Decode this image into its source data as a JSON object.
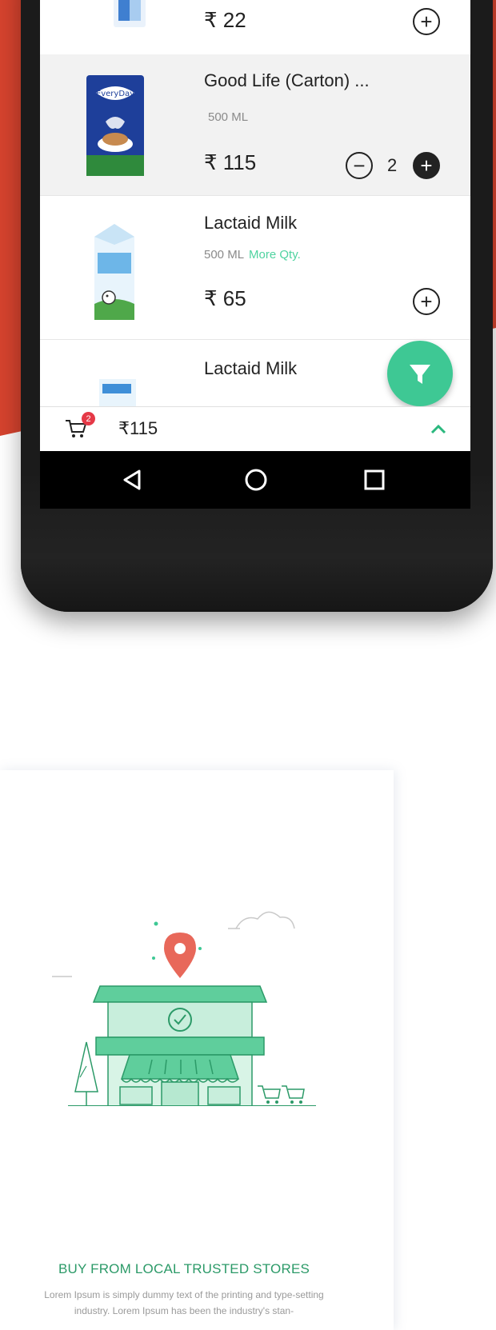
{
  "colors": {
    "accent_red": "#d6432e",
    "accent_green": "#3ec894",
    "store_green": "#2c9a68",
    "badge_red": "#e53947"
  },
  "products": [
    {
      "name": "",
      "size": "",
      "more_qty": "",
      "price": "₹ 22",
      "quantity": null
    },
    {
      "name": "Good Life (Carton) ...",
      "size": "500 ML",
      "more_qty": "",
      "price": "₹ 115",
      "quantity": "2"
    },
    {
      "name": "Lactaid Milk",
      "size": "500 ML",
      "more_qty": "More Qty.",
      "price": "₹ 65",
      "quantity": null
    },
    {
      "name": "Lactaid Milk",
      "size": "",
      "more_qty": "",
      "price": "",
      "quantity": null
    }
  ],
  "icons": {
    "add": "plus-circle-icon",
    "remove": "minus-circle-icon",
    "filter": "filter-icon",
    "cart": "cart-icon",
    "expand": "chevron-up-icon",
    "back": "back-triangle-icon",
    "home": "home-circle-icon",
    "recents": "recents-square-icon"
  },
  "cart": {
    "badge_count": "2",
    "total": "₹115"
  },
  "onboarding": {
    "title": "BUY FROM LOCAL TRUSTED STORES",
    "body": "Lorem Ipsum is simply dummy text of the printing and type-setting industry. Lorem Ipsum has been the industry's stan-"
  }
}
